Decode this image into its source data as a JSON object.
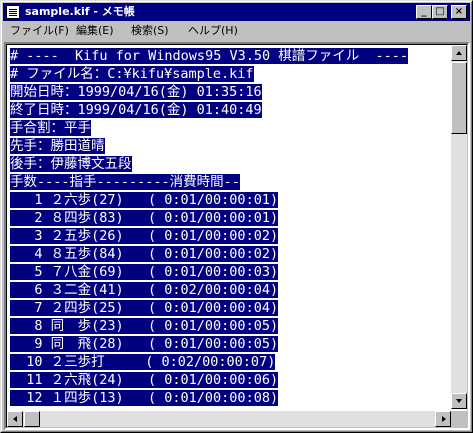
{
  "window": {
    "title": "sample.kif - メモ帳",
    "minimize_glyph": "_",
    "maximize_glyph": "□",
    "close_glyph": "×"
  },
  "menu": [
    {
      "label": "ファイル(F)"
    },
    {
      "label": "編集(E)"
    },
    {
      "label": "検索(S)"
    },
    {
      "label": "ヘルプ(H)"
    }
  ],
  "document": {
    "lines": [
      "# ----  Kifu for Windows95 V3.50 棋譜ファイル  ----",
      "# ファイル名：C:¥kifu¥sample.kif",
      "開始日時：1999/04/16(金) 01:35:16",
      "終了日時：1999/04/16(金) 01:40:49",
      "手合割：平手",
      "先手：勝田道晴",
      "後手：伊藤博文五段",
      "手数----指手---------消費時間--",
      "   1 ２六歩(27)   ( 0:01/00:00:01)",
      "   2 ８四歩(83)   ( 0:01/00:00:01)",
      "   3 ２五歩(26)   ( 0:01/00:00:02)",
      "   4 ８五歩(84)   ( 0:01/00:00:02)",
      "   5 ７八金(69)   ( 0:01/00:00:03)",
      "   6 ３二金(41)   ( 0:02/00:00:04)",
      "   7 ２四歩(25)   ( 0:01/00:00:04)",
      "   8 同　歩(23)   ( 0:01/00:00:05)",
      "   9 同　飛(28)   ( 0:01/00:00:05)",
      "  10 ２三歩打     ( 0:02/00:00:07)",
      "  11 ２六飛(24)   ( 0:01/00:00:06)",
      "  12 １四歩(13)   ( 0:01/00:00:08)"
    ]
  },
  "colors": {
    "title_bar": "#000080",
    "selection": "#000080",
    "window_face": "#c0c0c0"
  },
  "scroll": {
    "vertical_position": 0,
    "horizontal_position": 0
  }
}
